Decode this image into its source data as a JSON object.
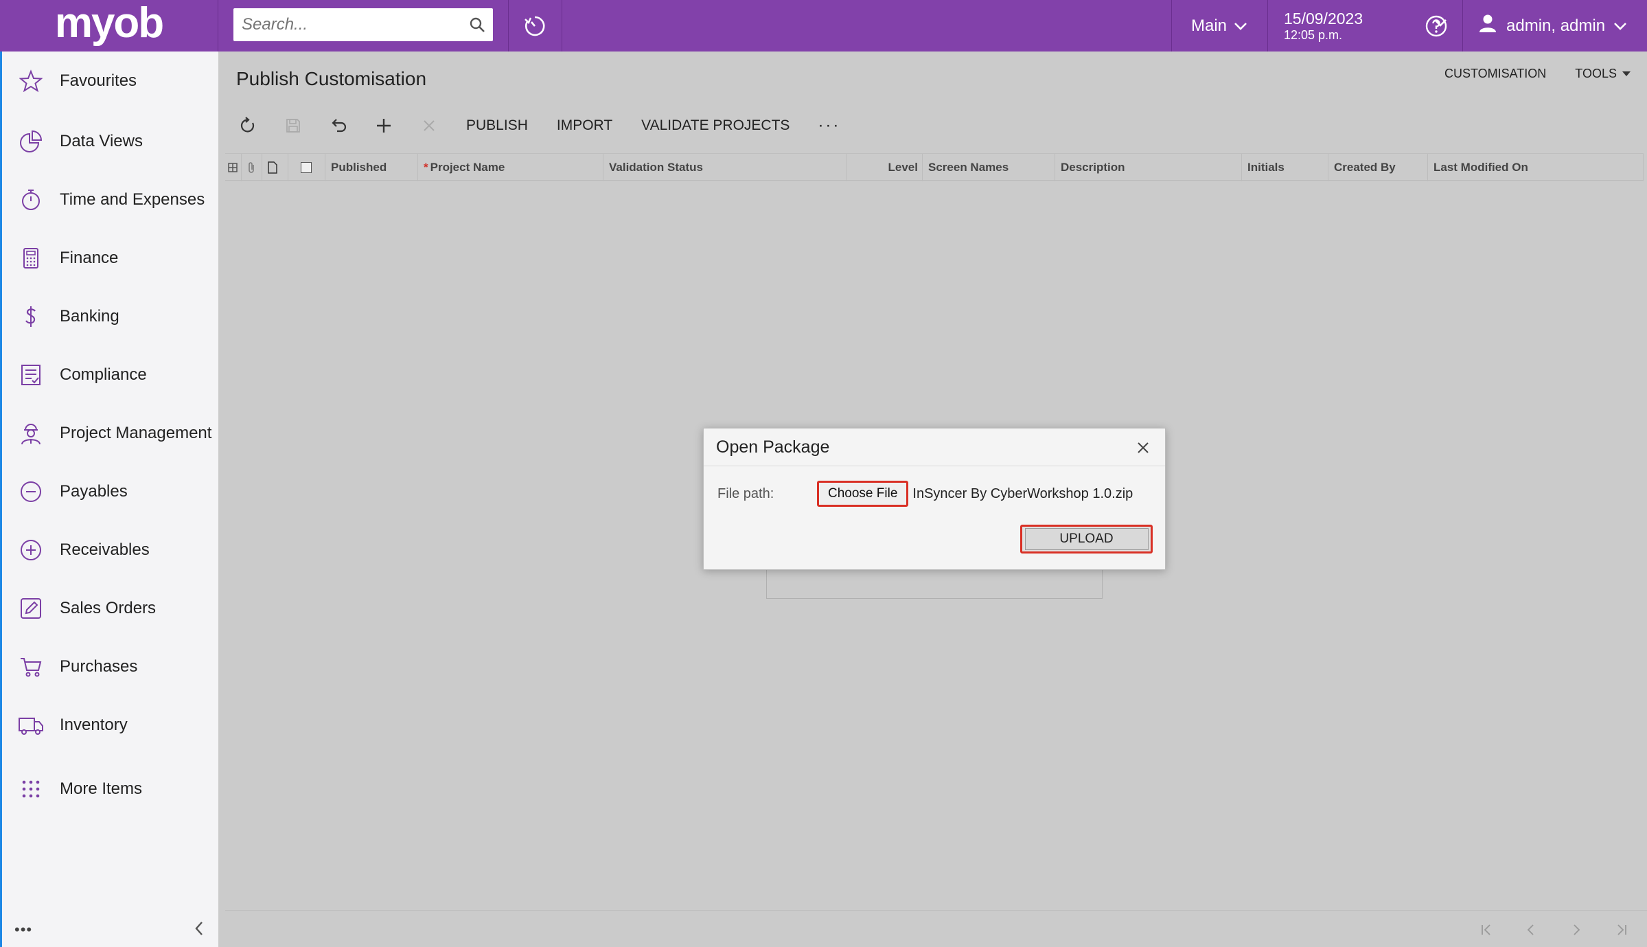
{
  "header": {
    "logo": "myob",
    "search_placeholder": "Search...",
    "company": "Main",
    "date": "15/09/2023",
    "time": "12:05 p.m.",
    "user": "admin, admin",
    "accent": "#8241aa"
  },
  "sidebar": {
    "items": [
      {
        "label": "Favourites",
        "icon": "star-icon"
      },
      {
        "label": "Data Views",
        "icon": "pie-chart-icon"
      },
      {
        "label": "Time and Expenses",
        "icon": "stopwatch-icon"
      },
      {
        "label": "Finance",
        "icon": "calculator-icon"
      },
      {
        "label": "Banking",
        "icon": "dollar-icon"
      },
      {
        "label": "Compliance",
        "icon": "checklist-icon"
      },
      {
        "label": "Project Management",
        "icon": "worker-icon"
      },
      {
        "label": "Payables",
        "icon": "minus-circle-icon"
      },
      {
        "label": "Receivables",
        "icon": "plus-circle-icon"
      },
      {
        "label": "Sales Orders",
        "icon": "edit-icon"
      },
      {
        "label": "Purchases",
        "icon": "cart-icon"
      },
      {
        "label": "Inventory",
        "icon": "truck-icon"
      },
      {
        "label": "More Items",
        "icon": "grid-dots-icon"
      }
    ],
    "more_dots": "•••"
  },
  "page": {
    "title": "Publish Customisation",
    "links": [
      "CUSTOMISATION",
      "TOOLS"
    ],
    "toolbar": {
      "publish": "PUBLISH",
      "import": "IMPORT",
      "validate": "VALIDATE PROJECTS",
      "more": "···"
    },
    "columns": {
      "published": "Published",
      "project_name": "Project Name",
      "required_mark": "*",
      "validation_status": "Validation Status",
      "level": "Level",
      "screen_names": "Screen Names",
      "description": "Description",
      "initials": "Initials",
      "created_by": "Created By",
      "last_modified_on": "Last Modified On"
    }
  },
  "dialog": {
    "title": "Open Package",
    "file_path_label": "File path:",
    "choose_file": "Choose File",
    "file_name": "InSyncer By CyberWorkshop 1.0.zip",
    "upload": "UPLOAD"
  }
}
